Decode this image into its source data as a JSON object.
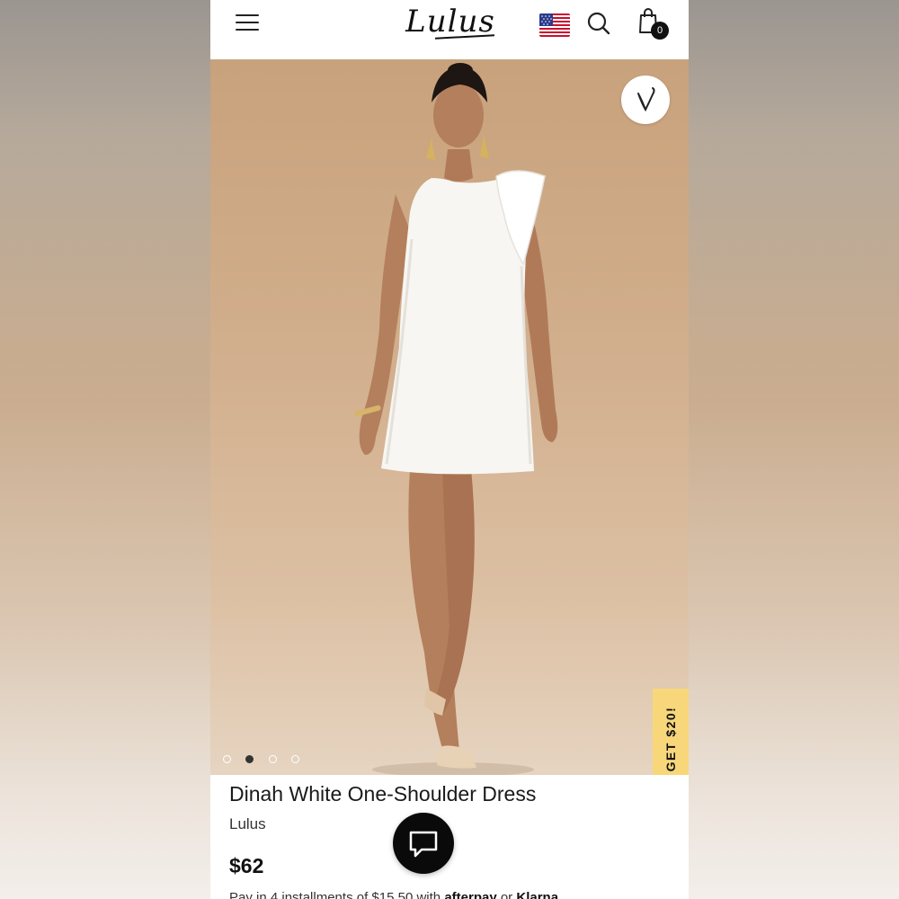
{
  "header": {
    "logo_text": "Lulus",
    "cart_count": "0",
    "icons": [
      "menu-icon",
      "us-flag-icon",
      "search-icon",
      "shopping-bag-icon"
    ]
  },
  "gallery": {
    "total_images": 4,
    "active_index": 1,
    "wishlist_icon": "heart-icon",
    "promo_label": "GET $20!"
  },
  "product": {
    "title": "Dinah White One-Shoulder Dress",
    "brand": "Lulus",
    "price": "$62",
    "installments_prefix": "Pay in 4 installments of $15.50 with",
    "afterpay_label": "afterpay",
    "or_label": "or",
    "klarna_label": "Klarna"
  },
  "chat": {
    "icon": "chat-bubble-icon"
  },
  "colors": {
    "promo_yellow": "#f8d77a",
    "background_tan": "#d1ae8c",
    "dress_white": "#f7f6f3",
    "chat_black": "#0a0a0a"
  }
}
